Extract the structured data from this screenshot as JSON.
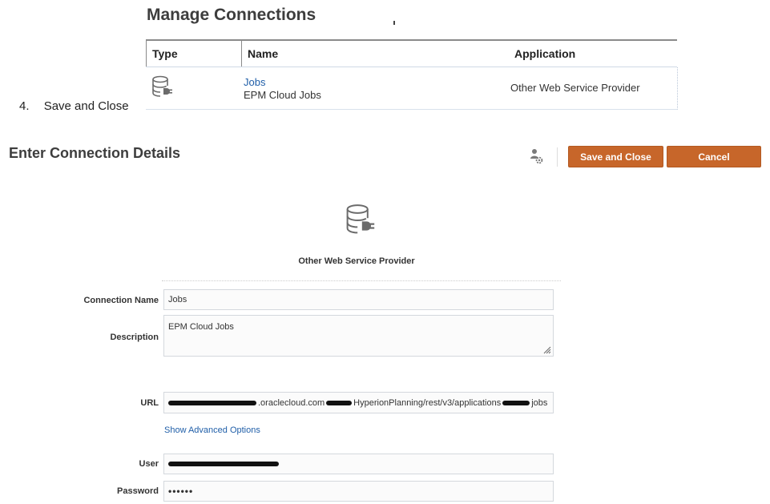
{
  "manage": {
    "title": "Manage Connections",
    "columns": [
      "Type",
      "Name",
      "Application"
    ],
    "row": {
      "name": "Jobs",
      "description": "EPM Cloud Jobs",
      "application": "Other Web Service Provider"
    }
  },
  "step": {
    "number": "4.",
    "text": "Save and Close"
  },
  "details": {
    "title": "Enter Connection Details",
    "save_label": "Save and Close",
    "cancel_label": "Cancel",
    "provider": "Other Web Service Provider",
    "fields": {
      "connection_name_label": "Connection Name",
      "connection_name_value": "Jobs",
      "description_label": "Description",
      "description_value": "EPM Cloud Jobs",
      "url_label": "URL",
      "url_part1": ".oraclecloud.com",
      "url_part2": "HyperionPlanning/rest/v3/applications",
      "url_part3": "jobs",
      "advanced_label": "Show Advanced Options",
      "user_label": "User",
      "password_label": "Password",
      "password_value": "••••••"
    }
  },
  "colors": {
    "accent": "#c7662a",
    "link": "#1f5ea8"
  },
  "icons": [
    "database-plug-icon",
    "user-settings-icon",
    "resize-grip-icon"
  ]
}
